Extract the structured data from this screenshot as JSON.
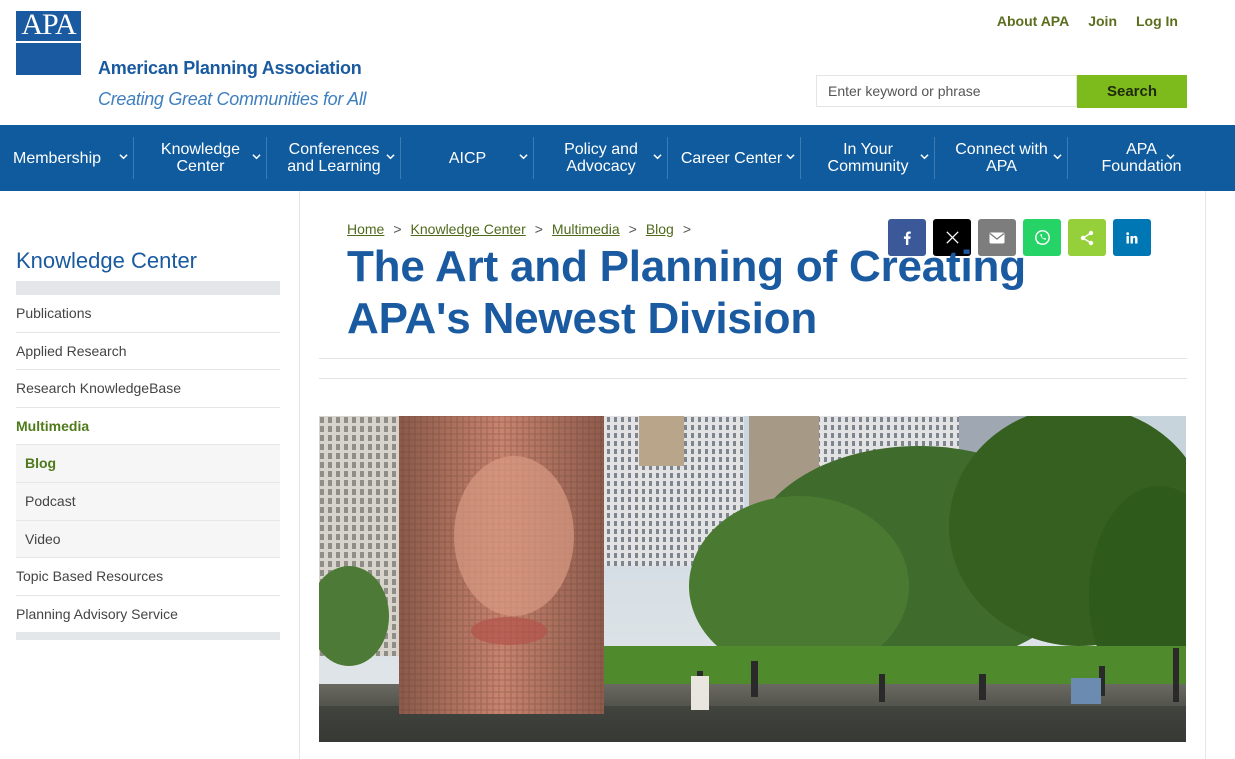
{
  "header": {
    "logo_text": "APA",
    "org_name": "American Planning Association",
    "tagline": "Creating Great Communities for All",
    "util_links": [
      "About APA",
      "Join",
      "Log In"
    ],
    "search": {
      "placeholder": "Enter keyword or phrase",
      "button_label": "Search"
    }
  },
  "nav": {
    "items": [
      {
        "label": "Membership"
      },
      {
        "label": "Knowledge Center"
      },
      {
        "label": "Conferences and Learning"
      },
      {
        "label": "AICP"
      },
      {
        "label": "Policy and Advocacy"
      },
      {
        "label": "Career Center"
      },
      {
        "label": "In Your Community"
      },
      {
        "label": "Connect with APA"
      },
      {
        "label": "APA Foundation"
      }
    ]
  },
  "sidebar": {
    "title": "Knowledge Center",
    "items": [
      {
        "label": "Publications"
      },
      {
        "label": "Applied Research"
      },
      {
        "label": "Research KnowledgeBase"
      },
      {
        "label": "Multimedia"
      },
      {
        "label": "Blog"
      },
      {
        "label": "Podcast"
      },
      {
        "label": "Video"
      },
      {
        "label": "Topic Based Resources"
      },
      {
        "label": "Planning Advisory Service"
      }
    ]
  },
  "breadcrumb": [
    "Home",
    "Knowledge Center",
    "Multimedia",
    "Blog"
  ],
  "breadcrumb_sep": ">",
  "share": {
    "colors": {
      "facebook": "#3b5998",
      "x": "#000000",
      "email": "#7d7d7d",
      "whatsapp": "#25d366",
      "sharethis": "#95d03a",
      "linkedin": "#0077b5"
    }
  },
  "article": {
    "title": "The Art and Planning of Creating APA's Newest Division"
  },
  "colors": {
    "brand_blue": "#1a5aa0",
    "nav_bg": "#0f5b9e",
    "search_green": "#7dbb1c",
    "link_green": "#4f6a1b"
  }
}
